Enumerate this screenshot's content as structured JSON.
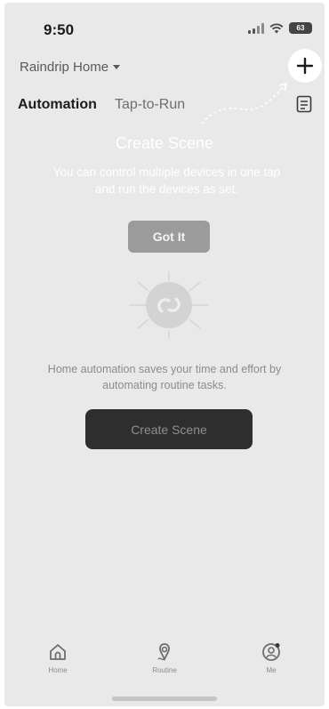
{
  "status_bar": {
    "time": "9:50",
    "battery": "63"
  },
  "header": {
    "home_name": "Raindrip Home",
    "add_icon": "plus-icon",
    "log_icon": "document-list-icon"
  },
  "tabs": [
    {
      "label": "Automation",
      "active": true
    },
    {
      "label": "Tap-to-Run",
      "active": false
    }
  ],
  "coach_mark": {
    "title": "Create Scene",
    "description": "You can control multiple devices in one tap and run the devices as set.",
    "button_label": "Got It"
  },
  "empty_state": {
    "illustration_icon": "automation-link-icon",
    "message": "Home automation saves your time and effort by automating routine tasks.",
    "button_label": "Create Scene"
  },
  "bottom_nav": [
    {
      "label": "Home",
      "icon": "home-icon"
    },
    {
      "label": "Routine",
      "icon": "routine-icon"
    },
    {
      "label": "Me",
      "icon": "profile-icon"
    }
  ],
  "colors": {
    "overlay_background": "#e9e9e9",
    "primary_button": "#2e2e2e",
    "coach_button": "#9b9b9b"
  }
}
